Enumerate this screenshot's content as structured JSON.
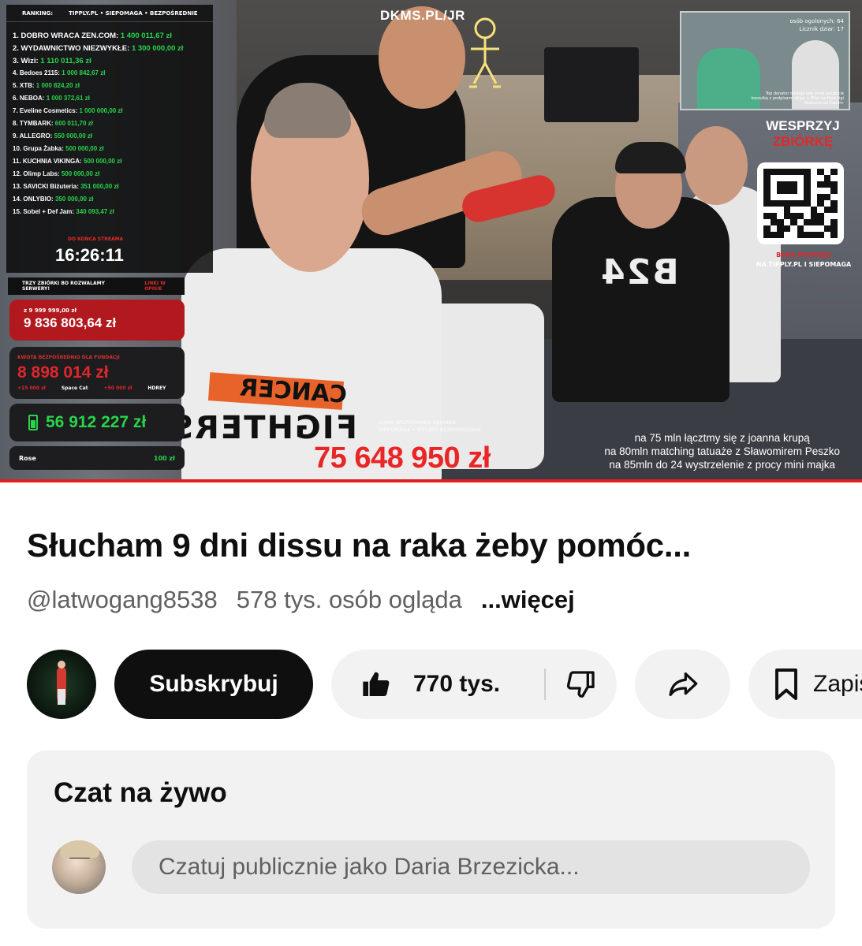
{
  "video": {
    "brand": "DKMS.PL/JR",
    "ranking": {
      "label": "RANKING:",
      "sources": "TIPPLY.PL • SIEPOMAGA • BEZPOŚREDNIE",
      "items": [
        {
          "name": "1. DOBRO WRACA ZEN.COM:",
          "amount": "1 400 011,67 zł"
        },
        {
          "name": "2. WYDAWNICTWO NIEZWYKŁE:",
          "amount": "1 300 000,00 zł"
        },
        {
          "name": "3. Wizi:",
          "amount": "1 110 011,36 zł"
        },
        {
          "name": "4. Bedoes 2115:",
          "amount": "1 000 842,67 zł"
        },
        {
          "name": "5. XTB:",
          "amount": "1 000 824,20 zł"
        },
        {
          "name": "6. NEBOA:",
          "amount": "1 000 372,61 zł"
        },
        {
          "name": "7. Eveline Cosmetics:",
          "amount": "1 000 000,00 zł"
        },
        {
          "name": "8. TYMBARK:",
          "amount": "600 011,70 zł"
        },
        {
          "name": "9. ALLEGRO:",
          "amount": "550 000,00 zł"
        },
        {
          "name": "10. Grupa Żabka:",
          "amount": "500 000,00 zł"
        },
        {
          "name": "11. KUCHNIA VIKINGA:",
          "amount": "500 000,00 zł"
        },
        {
          "name": "12. Olimp Labs:",
          "amount": "500 000,00 zł"
        },
        {
          "name": "13. SAVICKI Biżuteria:",
          "amount": "351 000,00 zł"
        },
        {
          "name": "14. ONLYBIO:",
          "amount": "350 000,00 zł"
        },
        {
          "name": "15. Sobel + Def Jam:",
          "amount": "340 093,47 zł"
        }
      ],
      "timer_label": "DO KOŃCA STREAMA",
      "timer": "16:26:11"
    },
    "panel": {
      "title": "TRZY ZBIÓRKI BO ROZWALAMY SERWERY!",
      "link": "LINKI W OPISIE",
      "goal_small": "z 9 999 999,00 zł",
      "goal_big": "9 836 803,64 zł",
      "direct_label": "KWOTA BEZPOŚREDNIO DLA FUNDACJI",
      "direct_value": "8 898 014 zł",
      "direct_sub1": "+15 000 zł",
      "direct_sub2": "Space Cat",
      "direct_sub3": "+50 000 zł",
      "direct_sub4": "HDREY",
      "battery_value": "56 912 227 zł",
      "donor_name": "Rose",
      "donor_amount": "100 zł"
    },
    "inset": {
      "top_line1": "osób ogolonych: 64",
      "top_line2": "Licznik dziar: 17",
      "bottom_text": "Top donator dostaje ode mnie osobiście koszulkę z podpisami ekipy + Bilet na finał Ligi Mistrzów od Canal+"
    },
    "support": {
      "line1": "WESPRZYJ",
      "line2": "ZBIÓRKĘ"
    },
    "fees": {
      "line1": "BRAK PROWIZJI",
      "line2": "NA TIPPLY.PL I SIEPOMAGA"
    },
    "total_label1": "SUMA WSZYSTKICH ZBIÓREK",
    "total_label2": "SIEPOMAGA • WPŁATY BEZPOŚREDNIE",
    "total": "75 648 950 zł",
    "milestones": [
      "na 75 mln łącztmy się z joanna krupą",
      "na 80mln matching tatuaże z Sławomirem Peszko",
      "na 85mln do 24 wystrzelenie z procy mini majka"
    ],
    "shirt_line1": "CANCER",
    "shirt_line2": "FIGHTERS",
    "shirt_b24": "B24",
    "progress": 1.0,
    "accent": "#e02020"
  },
  "title": "Słucham 9 dni dissu na raka żeby pomóc...",
  "channel": "@latwogang8538",
  "viewers": "578 tys. osób ogląda",
  "more": "...więcej",
  "actions": {
    "subscribe": "Subskrybuj",
    "likes": "770 tys.",
    "save": "Zapisz",
    "icons": [
      "thumbs-up-icon",
      "thumbs-down-icon",
      "share-icon",
      "bookmark-icon"
    ]
  },
  "chat": {
    "title": "Czat na żywo",
    "placeholder": "Czatuj publicznie jako Daria Brzezicka..."
  },
  "colors": {
    "brand_red": "#e02a2a",
    "green": "#29d44b",
    "button_bg": "#f2f2f2",
    "subscribe_bg": "#0f0f0f"
  }
}
